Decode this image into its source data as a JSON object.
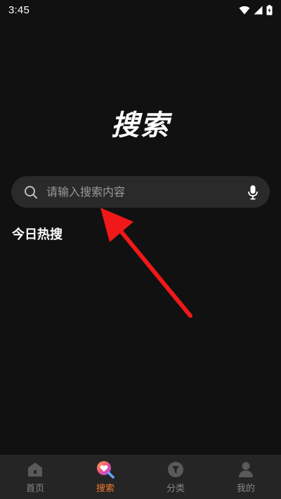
{
  "status_bar": {
    "time": "3:45"
  },
  "page": {
    "title": "搜索"
  },
  "search": {
    "placeholder": "请输入搜索内容",
    "value": "",
    "icon": "search-icon",
    "voice_icon": "microphone-icon"
  },
  "hot_search": {
    "heading": "今日热搜"
  },
  "bottom_nav": {
    "items": [
      {
        "label": "首页",
        "icon": "home-icon",
        "active": false
      },
      {
        "label": "搜索",
        "icon": "search-tab-icon",
        "active": true
      },
      {
        "label": "分类",
        "icon": "category-icon",
        "active": false
      },
      {
        "label": "我的",
        "icon": "profile-icon",
        "active": false
      }
    ]
  },
  "colors": {
    "background": "#111111",
    "search_bg": "#2a2a2a",
    "nav_bg": "#252525",
    "active_tab": "#f07a2f",
    "inactive_tab": "#888888",
    "annotation_arrow": "#f01818"
  }
}
